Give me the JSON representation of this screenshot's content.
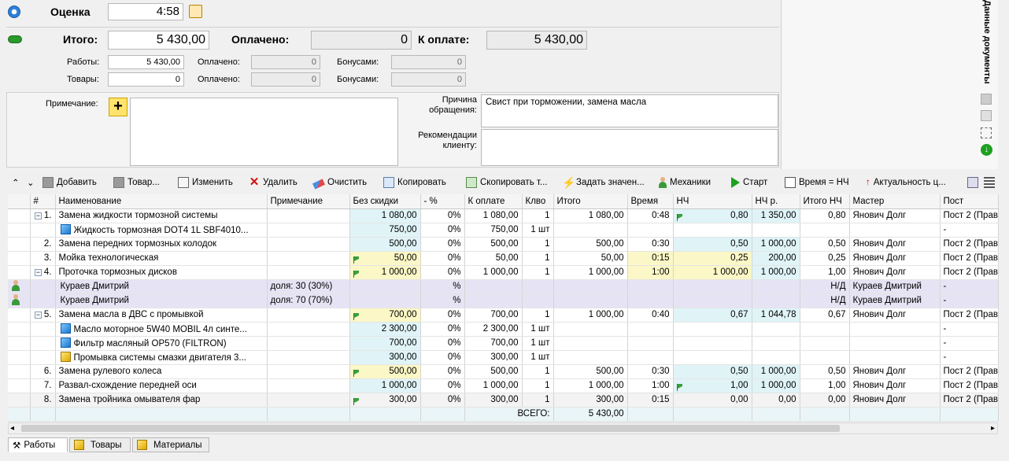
{
  "estimate": {
    "label": "Оценка",
    "value": "4:58"
  },
  "totals": {
    "itogo_label": "Итого:",
    "itogo": "5 430,00",
    "paid_label": "Оплачено:",
    "paid": "0",
    "topay_label": "К оплате:",
    "topay": "5 430,00"
  },
  "breakdown": {
    "works_label": "Работы:",
    "works": "5 430,00",
    "goods_label": "Товары:",
    "goods": "0",
    "paid_label": "Оплачено:",
    "paid_works": "0",
    "paid_goods": "0",
    "bonus_label": "Бонусами:",
    "bonus_works": "0",
    "bonus_goods": "0"
  },
  "notes": {
    "note_label": "Примечание:",
    "reason_label": "Причина обращения:",
    "reason_value": "Свист при торможении, замена масла",
    "recom_label": "Рекомендации клиенту:"
  },
  "side_label": "Данные документы",
  "toolbar": {
    "add": "Добавить",
    "goods": "Товар...",
    "edit": "Изменить",
    "delete": "Удалить",
    "clear": "Очистить",
    "copy": "Копировать",
    "copy_to": "Скопировать т...",
    "set_value": "Задать значен...",
    "mechanics": "Механики",
    "start": "Старт",
    "time_nh": "Время = НЧ",
    "actual": "Актуальность ц..."
  },
  "columns": [
    "#",
    "Наименование",
    "Примечание",
    "Без скидки",
    "- %",
    "К оплате",
    "Клво",
    "Итого",
    "Время",
    "НЧ",
    "НЧ р.",
    "Итого НЧ",
    "Мастер",
    "Пост"
  ],
  "rows": [
    {
      "num": "1.",
      "name": "Замена жидкости тормозной системы",
      "note": "",
      "nodisc": "1 080,00",
      "pct": "0%",
      "pay": "1 080,00",
      "qty": "1",
      "total": "1 080,00",
      "time": "0:48",
      "nh": "0,80",
      "nhr": "1 350,00",
      "totnh": "0,80",
      "master": "Янович Долг",
      "post": "Пост 2 (Прав"
    },
    {
      "num": "",
      "name": "Жидкость тормозная DOT4 1L SBF4010...",
      "note": "",
      "nodisc": "750,00",
      "pct": "0%",
      "pay": "750,00",
      "qty": "1 шт",
      "total": "",
      "time": "",
      "nh": "",
      "nhr": "",
      "totnh": "",
      "master": "",
      "post": "-"
    },
    {
      "num": "2.",
      "name": "Замена передних тормозных колодок",
      "note": "",
      "nodisc": "500,00",
      "pct": "0%",
      "pay": "500,00",
      "qty": "1",
      "total": "500,00",
      "time": "0:30",
      "nh": "0,50",
      "nhr": "1 000,00",
      "totnh": "0,50",
      "master": "Янович Долг",
      "post": "Пост 2 (Прав"
    },
    {
      "num": "3.",
      "name": "Мойка технологическая",
      "note": "",
      "nodisc": "50,00",
      "pct": "0%",
      "pay": "50,00",
      "qty": "1",
      "total": "50,00",
      "time": "0:15",
      "nh": "0,25",
      "nhr": "200,00",
      "totnh": "0,25",
      "master": "Янович Долг",
      "post": "Пост 2 (Прав"
    },
    {
      "num": "4.",
      "name": "Проточка тормозных дисков",
      "note": "",
      "nodisc": "1 000,00",
      "pct": "0%",
      "pay": "1 000,00",
      "qty": "1",
      "total": "1 000,00",
      "time": "1:00",
      "nh": "1 000,00",
      "nhr": "1 000,00",
      "totnh": "1,00",
      "master": "Янович Долг",
      "post": "Пост 2 (Прав"
    },
    {
      "num": "",
      "name": "Кураев Дмитрий",
      "note": "доля: 30 (30%)",
      "nodisc": "",
      "pct": "%",
      "pay": "",
      "qty": "",
      "total": "",
      "time": "",
      "nh": "",
      "nhr": "",
      "totnh": "Н/Д",
      "master": "Кураев Дмитрий",
      "post": "-"
    },
    {
      "num": "",
      "name": "Кураев Дмитрий",
      "note": "доля: 70 (70%)",
      "nodisc": "",
      "pct": "%",
      "pay": "",
      "qty": "",
      "total": "",
      "time": "",
      "nh": "",
      "nhr": "",
      "totnh": "Н/Д",
      "master": "Кураев Дмитрий",
      "post": "-"
    },
    {
      "num": "5.",
      "name": "Замена масла в ДВС с промывкой",
      "note": "",
      "nodisc": "700,00",
      "pct": "0%",
      "pay": "700,00",
      "qty": "1",
      "total": "1 000,00",
      "time": "0:40",
      "nh": "0,67",
      "nhr": "1 044,78",
      "totnh": "0,67",
      "master": "Янович Долг",
      "post": "Пост 2 (Прав"
    },
    {
      "num": "",
      "name": "Масло моторное 5W40 MOBIL 4л синте...",
      "note": "",
      "nodisc": "2 300,00",
      "pct": "0%",
      "pay": "2 300,00",
      "qty": "1 шт",
      "total": "",
      "time": "",
      "nh": "",
      "nhr": "",
      "totnh": "",
      "master": "",
      "post": "-"
    },
    {
      "num": "",
      "name": "Фильтр масляный OP570 (FILTRON)",
      "note": "",
      "nodisc": "700,00",
      "pct": "0%",
      "pay": "700,00",
      "qty": "1 шт",
      "total": "",
      "time": "",
      "nh": "",
      "nhr": "",
      "totnh": "",
      "master": "",
      "post": "-"
    },
    {
      "num": "",
      "name": "Промывка системы смазки двигателя 3...",
      "note": "",
      "nodisc": "300,00",
      "pct": "0%",
      "pay": "300,00",
      "qty": "1 шт",
      "total": "",
      "time": "",
      "nh": "",
      "nhr": "",
      "totnh": "",
      "master": "",
      "post": "-"
    },
    {
      "num": "6.",
      "name": "Замена рулевого колеса",
      "note": "",
      "nodisc": "500,00",
      "pct": "0%",
      "pay": "500,00",
      "qty": "1",
      "total": "500,00",
      "time": "0:30",
      "nh": "0,50",
      "nhr": "1 000,00",
      "totnh": "0,50",
      "master": "Янович Долг",
      "post": "Пост 2 (Прав"
    },
    {
      "num": "7.",
      "name": "Развал-схождение передней оси",
      "note": "",
      "nodisc": "1 000,00",
      "pct": "0%",
      "pay": "1 000,00",
      "qty": "1",
      "total": "1 000,00",
      "time": "1:00",
      "nh": "1,00",
      "nhr": "1 000,00",
      "totnh": "1,00",
      "master": "Янович Долг",
      "post": "Пост 2 (Прав"
    },
    {
      "num": "8.",
      "name": "Замена тройника омывателя фар",
      "note": "",
      "nodisc": "300,00",
      "pct": "0%",
      "pay": "300,00",
      "qty": "1",
      "total": "300,00",
      "time": "0:15",
      "nh": "0,00",
      "nhr": "0,00",
      "totnh": "0,00",
      "master": "Янович Долг",
      "post": "Пост 2 (Прав"
    }
  ],
  "footer": {
    "label": "ВСЕГО:",
    "total": "5 430,00"
  },
  "tabs": {
    "works": "Работы",
    "goods": "Товары",
    "materials": "Материалы"
  },
  "colors": {
    "accent_cyan": "#e0f4f8",
    "accent_yellow": "#fbf7c6",
    "mechanic_row": "#e6e4f4"
  }
}
